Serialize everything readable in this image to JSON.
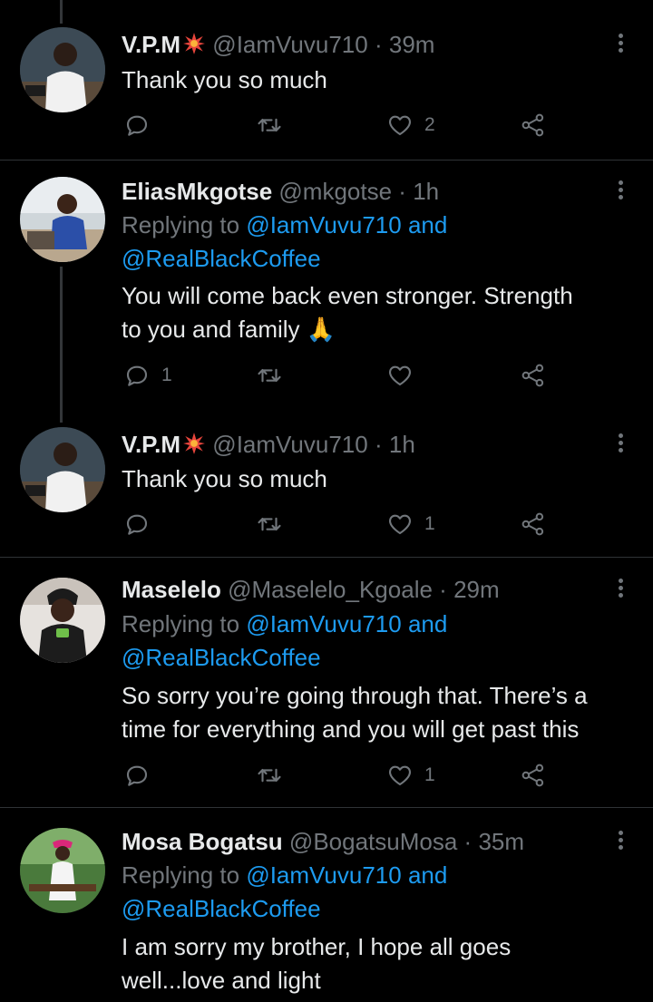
{
  "tweets": [
    {
      "name": "V.P.M",
      "name_badge": "sparkle-badge",
      "handle": "@IamVuvu710",
      "time": "39m",
      "replying_prefix": "",
      "lines": [
        "Thank you so much"
      ],
      "reply_count": "",
      "like_count": "2"
    },
    {
      "name": "EliasMkgotse",
      "handle": "@mkgotse",
      "time": "1h",
      "replying_prefix": "Replying to",
      "replying_link1": "@IamVuvu710 and",
      "replying_link2": "@RealBlackCoffee",
      "lines": [
        "You will come back even stronger. Strength",
        "to you and family"
      ],
      "emoji": "🙏",
      "reply_count": "1",
      "like_count": ""
    },
    {
      "name": "V.P.M",
      "name_badge": "sparkle-badge",
      "handle": "@IamVuvu710",
      "time": "1h",
      "lines": [
        "Thank you so much"
      ],
      "reply_count": "",
      "like_count": "1"
    },
    {
      "name": "Maselelo",
      "handle": "@Maselelo_Kgoale",
      "time": "29m",
      "replying_prefix": "Replying to",
      "replying_link1": "@IamVuvu710 and",
      "replying_link2": "@RealBlackCoffee",
      "lines": [
        "So sorry you’re going through that. There’s a",
        "time for everything and you will get past this"
      ],
      "reply_count": "",
      "like_count": "1"
    },
    {
      "name": "Mosa Bogatsu",
      "handle": "@BogatsuMosa",
      "time": "35m",
      "replying_prefix": "Replying to",
      "replying_link1": "@IamVuvu710 and",
      "replying_link2": "@RealBlackCoffee",
      "lines": [
        "I am sorry my brother, I hope all goes",
        "well...love and light"
      ]
    }
  ],
  "separator": "·",
  "icons": {
    "reply": "reply-icon",
    "retweet": "retweet-icon",
    "like": "heart-icon",
    "share": "share-icon",
    "more": "more-vertical-icon"
  },
  "colors": {
    "background": "#000000",
    "text": "#e7e9ea",
    "muted": "#71767b",
    "link": "#1d9bf0",
    "divider": "#2f3336"
  }
}
